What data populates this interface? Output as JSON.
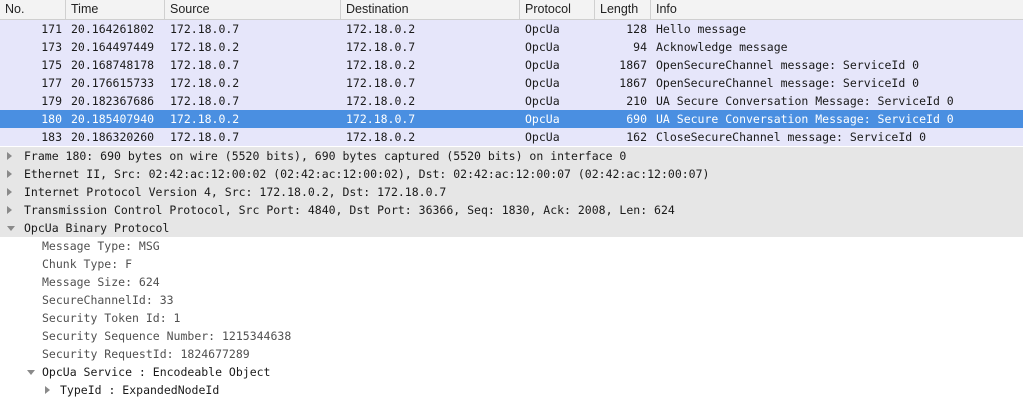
{
  "packet_list": {
    "columns": [
      "No.",
      "Time",
      "Source",
      "Destination",
      "Protocol",
      "Length",
      "Info"
    ],
    "rows": [
      {
        "no": "171",
        "time": "20.164261802",
        "source": "172.18.0.7",
        "destination": "172.18.0.2",
        "protocol": "OpcUa",
        "length": "128",
        "info": "Hello message",
        "selected": false
      },
      {
        "no": "173",
        "time": "20.164497449",
        "source": "172.18.0.2",
        "destination": "172.18.0.7",
        "protocol": "OpcUa",
        "length": "94",
        "info": "Acknowledge message",
        "selected": false
      },
      {
        "no": "175",
        "time": "20.168748178",
        "source": "172.18.0.7",
        "destination": "172.18.0.2",
        "protocol": "OpcUa",
        "length": "1867",
        "info": "OpenSecureChannel message: ServiceId 0",
        "selected": false
      },
      {
        "no": "177",
        "time": "20.176615733",
        "source": "172.18.0.2",
        "destination": "172.18.0.7",
        "protocol": "OpcUa",
        "length": "1867",
        "info": "OpenSecureChannel message: ServiceId 0",
        "selected": false
      },
      {
        "no": "179",
        "time": "20.182367686",
        "source": "172.18.0.7",
        "destination": "172.18.0.2",
        "protocol": "OpcUa",
        "length": "210",
        "info": "UA Secure Conversation Message: ServiceId 0",
        "selected": false
      },
      {
        "no": "180",
        "time": "20.185407940",
        "source": "172.18.0.2",
        "destination": "172.18.0.7",
        "protocol": "OpcUa",
        "length": "690",
        "info": "UA Secure Conversation Message: ServiceId 0",
        "selected": true
      },
      {
        "no": "183",
        "time": "20.186320260",
        "source": "172.18.0.7",
        "destination": "172.18.0.2",
        "protocol": "OpcUa",
        "length": "162",
        "info": "CloseSecureChannel message: ServiceId 0",
        "selected": false
      }
    ]
  },
  "details": [
    {
      "text": "Frame 180: 690 bytes on wire (5520 bits), 690 bytes captured (5520 bits) on interface 0",
      "level": 0,
      "expander": "closed",
      "shaded": true
    },
    {
      "text": "Ethernet II, Src: 02:42:ac:12:00:02 (02:42:ac:12:00:02), Dst: 02:42:ac:12:00:07 (02:42:ac:12:00:07)",
      "level": 0,
      "expander": "closed",
      "shaded": true
    },
    {
      "text": "Internet Protocol Version 4, Src: 172.18.0.2, Dst: 172.18.0.7",
      "level": 0,
      "expander": "closed",
      "shaded": true
    },
    {
      "text": "Transmission Control Protocol, Src Port: 4840, Dst Port: 36366, Seq: 1830, Ack: 2008, Len: 624",
      "level": 0,
      "expander": "closed",
      "shaded": true
    },
    {
      "text": "OpcUa Binary Protocol",
      "level": 0,
      "expander": "open",
      "shaded": true
    },
    {
      "text": "Message Type: MSG",
      "level": 1,
      "expander": "none",
      "shaded": false
    },
    {
      "text": "Chunk Type: F",
      "level": 1,
      "expander": "none",
      "shaded": false
    },
    {
      "text": "Message Size: 624",
      "level": 1,
      "expander": "none",
      "shaded": false
    },
    {
      "text": "SecureChannelId: 33",
      "level": 1,
      "expander": "none",
      "shaded": false
    },
    {
      "text": "Security Token Id: 1",
      "level": 1,
      "expander": "none",
      "shaded": false
    },
    {
      "text": "Security Sequence Number: 1215344638",
      "level": 1,
      "expander": "none",
      "shaded": false
    },
    {
      "text": "Security RequestId: 1824677289",
      "level": 1,
      "expander": "none",
      "shaded": false
    },
    {
      "text": "OpcUa Service : Encodeable Object",
      "level": 1,
      "expander": "open",
      "shaded": false
    },
    {
      "text": "TypeId : ExpandedNodeId",
      "level": 2,
      "expander": "closed",
      "shaded": false
    }
  ]
}
